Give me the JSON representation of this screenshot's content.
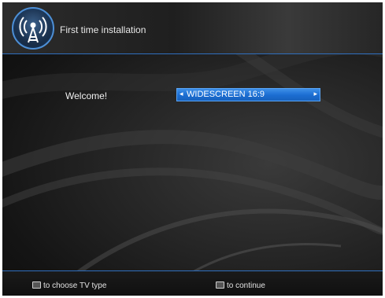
{
  "header": {
    "title": "First time installation",
    "icon": "antenna-icon",
    "accent_color": "#4d8fd6"
  },
  "main": {
    "welcome_label": "Welcome!",
    "tv_type_selector": {
      "value": "WIDESCREEN 16:9",
      "left_arrow": "◂",
      "right_arrow": "▸",
      "highlight_color": "#1b6dd1"
    }
  },
  "footer": {
    "hint_left": "to choose TV type",
    "hint_right": "to continue"
  }
}
